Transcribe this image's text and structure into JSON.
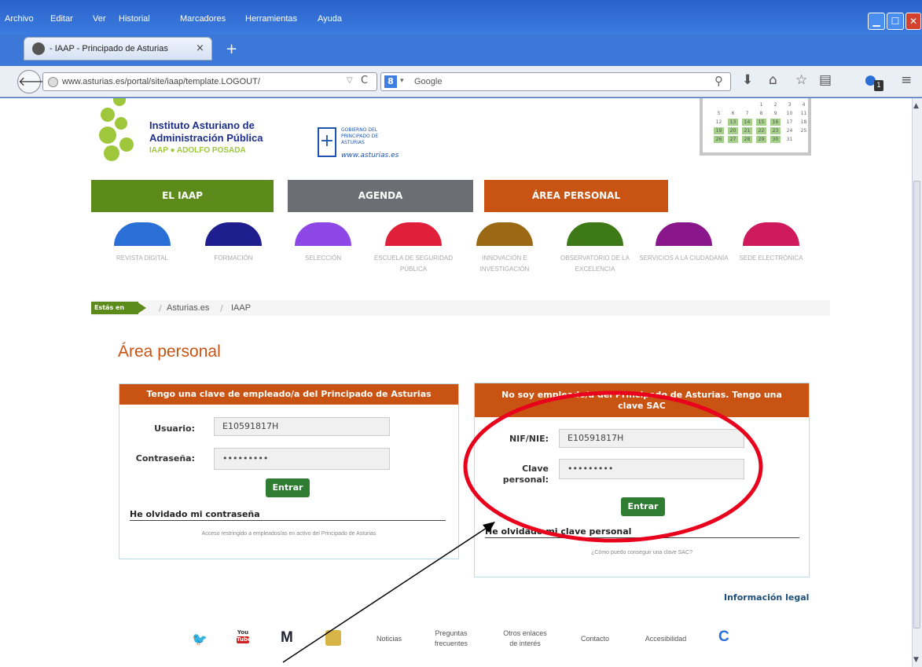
{
  "menu": [
    "Archivo",
    "Editar",
    "Ver",
    "Historial",
    "Marcadores",
    "Herramientas",
    "Ayuda"
  ],
  "tab": {
    "title": "- IAAP - Principado de Asturias",
    "close": "×",
    "new": "+"
  },
  "address": {
    "url": "www.asturias.es/portal/site/iaap/template.LOGOUT/",
    "search_placeholder": "Google",
    "badge": "1"
  },
  "header": {
    "inst_line1": "Instituto Asturiano de",
    "inst_line2": "Administración Pública",
    "inst_line3": "IAAP ● ADOLFO POSADA",
    "gov_line1": "GOBIERNO DEL",
    "gov_line2": "PRINCIPADO DE",
    "gov_line3": "ASTURIAS",
    "gov_url": "www.asturias.es"
  },
  "calendar": {
    "rows": [
      [
        "",
        "",
        "",
        "1",
        "2",
        "3",
        "4"
      ],
      [
        "5",
        "6",
        "7",
        "8",
        "9",
        "10",
        "11"
      ],
      [
        "12",
        "13",
        "14",
        "15",
        "16",
        "17",
        "18"
      ],
      [
        "19",
        "20",
        "21",
        "22",
        "23",
        "24",
        "25"
      ],
      [
        "26",
        "27",
        "28",
        "29",
        "30",
        "31",
        ""
      ]
    ]
  },
  "main_nav": [
    "EL IAAP",
    "AGENDA",
    "ÁREA PERSONAL"
  ],
  "sections": [
    {
      "label": "REVISTA DIGITAL",
      "color": "#2a6fd6"
    },
    {
      "label": "FORMACIÓN",
      "color": "#1f1e8f"
    },
    {
      "label": "SELECCIÓN",
      "color": "#8d47e6"
    },
    {
      "label": "ESCUELA DE SEGURIDAD PÚBLICA",
      "color": "#e0203b"
    },
    {
      "label": "INNOVACIÓN E INVESTIGACIÓN",
      "color": "#9b6913"
    },
    {
      "label": "OBSERVATORIO DE LA EXCELENCIA",
      "color": "#3d7a17"
    },
    {
      "label": "SERVICIOS A LA CIUDADANÍA",
      "color": "#8a168c"
    },
    {
      "label": "SEDE ELECTRÓNICA",
      "color": "#cf1b5e"
    }
  ],
  "breadcrumb": {
    "label": "Estás en",
    "items": [
      "Asturias.es",
      "IAAP"
    ],
    "sep": "/"
  },
  "page_title": "Área personal",
  "employee_panel": {
    "title": "Tengo una clave de empleado/a del Principado de Asturias",
    "user_label": "Usuario:",
    "user_value": "E10591817H",
    "pass_label": "Contraseña:",
    "pass_value": "•••••••••",
    "submit": "Entrar",
    "forgot": "He olvidado mi contraseña",
    "note": "Acceso restringido a empleados/as en activo del Principado de Asturias"
  },
  "sac_panel": {
    "title_line1": "No soy empleado/a del Principado de Asturias. Tengo una",
    "title_line2": "clave SAC",
    "nif_label": "NIF/NIE:",
    "nif_value": "E10591817H",
    "key_label_line1": "Clave",
    "key_label_line2": "personal:",
    "key_value": "•••••••••",
    "submit": "Entrar",
    "forgot": "He olvidado mi clave personal",
    "note": "¿Cómo puedo conseguir una clave SAC?"
  },
  "legal": "Información legal",
  "footer": {
    "youtube_top": "You",
    "youtube_bottom": "Tube",
    "m_logo": "M",
    "c_logo": "C",
    "links": [
      {
        "l1": "Noticias",
        "l2": ""
      },
      {
        "l1": "Preguntas",
        "l2": "frecuentes"
      },
      {
        "l1": "Otros enlaces",
        "l2": "de interés"
      },
      {
        "l1": "Contacto",
        "l2": ""
      },
      {
        "l1": "Accesibilidad",
        "l2": ""
      }
    ]
  },
  "colors": {
    "annotation": "#e8001c",
    "panel_head": "#c85312",
    "button": "#2f7d32"
  }
}
